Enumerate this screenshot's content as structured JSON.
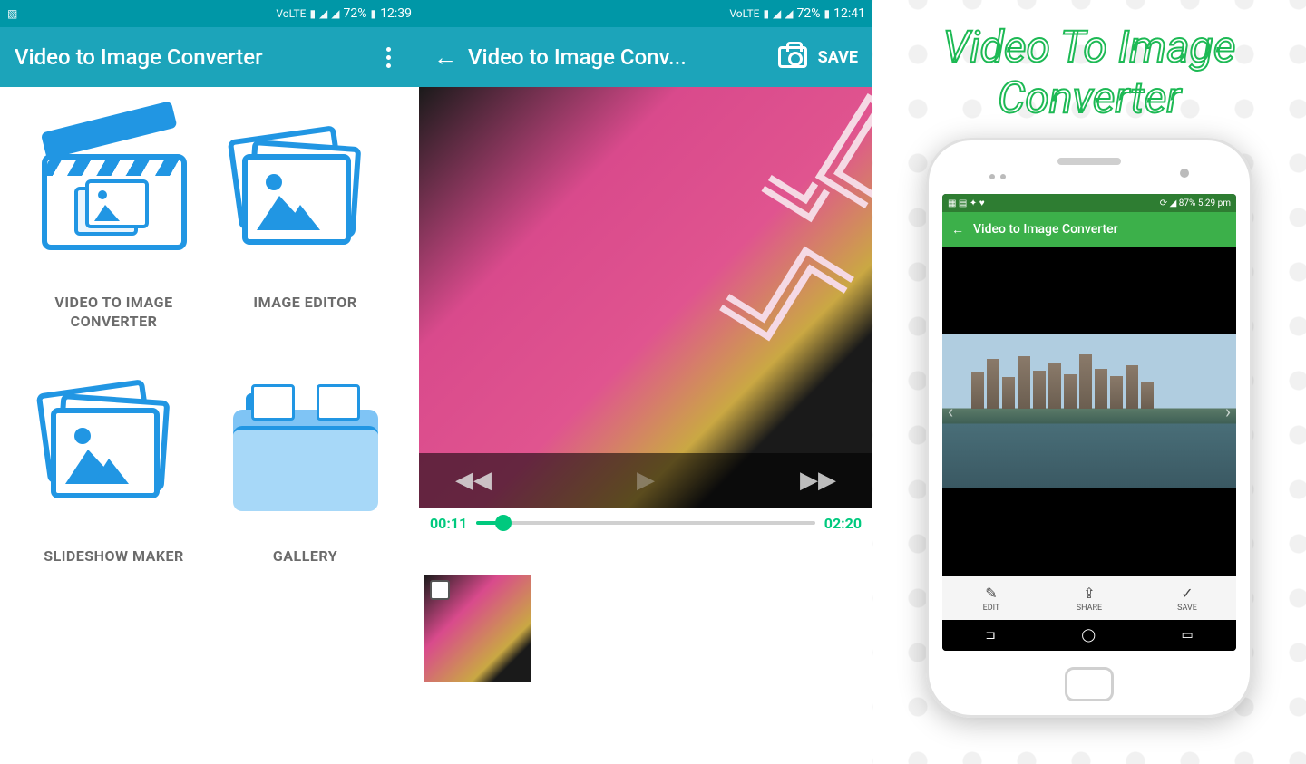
{
  "panel1": {
    "status": {
      "network": "VoLTE",
      "battery": "72%",
      "time": "12:39"
    },
    "title": "Video to Image Converter",
    "items": [
      {
        "label": "VIDEO TO IMAGE CONVERTER"
      },
      {
        "label": "IMAGE EDITOR"
      },
      {
        "label": "SLIDESHOW MAKER"
      },
      {
        "label": "GALLERY"
      }
    ]
  },
  "panel2": {
    "status": {
      "network": "VoLTE",
      "battery": "72%",
      "time": "12:41"
    },
    "title": "Video to Image Conv...",
    "save": "SAVE",
    "current": "00:11",
    "duration": "02:20"
  },
  "panel3": {
    "promo_line1": "Video To Image",
    "promo_line2": "Converter",
    "status": {
      "battery": "87%",
      "time": "5:29 pm"
    },
    "title": "Video to Image Converter",
    "actions": [
      {
        "label": "EDIT"
      },
      {
        "label": "SHARE"
      },
      {
        "label": "SAVE"
      }
    ]
  }
}
